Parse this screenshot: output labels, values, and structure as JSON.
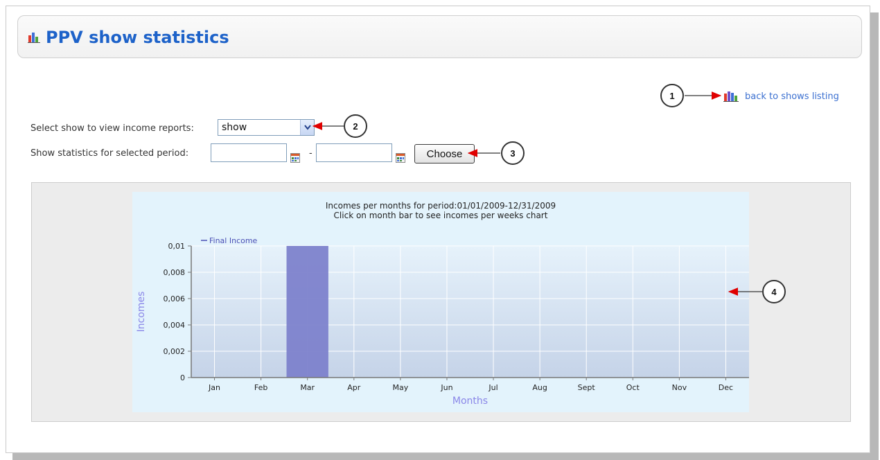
{
  "header": {
    "title": "PPV show statistics",
    "title_icon": "bar-chart-icon"
  },
  "back_link": {
    "label": "back to shows listing",
    "icon": "bar-chart-icon"
  },
  "form": {
    "select_label": "Select show to view income reports:",
    "select_value": "show",
    "period_label": "Show statistics for selected period:",
    "date_from": "",
    "date_to": "",
    "date_separator": "-",
    "choose_label": "Choose"
  },
  "callouts": [
    "1",
    "2",
    "3",
    "4"
  ],
  "colors": {
    "title": "#1d62c9",
    "link": "#3a6fd0",
    "bar": "#7d82cc",
    "arrow": "#e00000",
    "axis_label": "#8a86e8"
  },
  "chart_data": {
    "type": "bar",
    "title": "Incomes per months for period:01/01/2009-12/31/2009",
    "subtitle": "Click on month bar to see incomes per weeks chart",
    "xlabel": "Months",
    "ylabel": "Incomes",
    "categories": [
      "Jan",
      "Feb",
      "Mar",
      "Apr",
      "May",
      "Jun",
      "Jul",
      "Aug",
      "Sept",
      "Oct",
      "Nov",
      "Dec"
    ],
    "series": [
      {
        "name": "Final Income",
        "values": [
          0,
          0,
          0.01,
          0,
          0,
          0,
          0,
          0,
          0,
          0,
          0,
          0
        ]
      }
    ],
    "ylim": [
      0,
      0.01
    ],
    "yticks": [
      "0",
      "0,002",
      "0,004",
      "0,006",
      "0,008",
      "0,01"
    ],
    "grid": true,
    "legend": "top-left"
  }
}
